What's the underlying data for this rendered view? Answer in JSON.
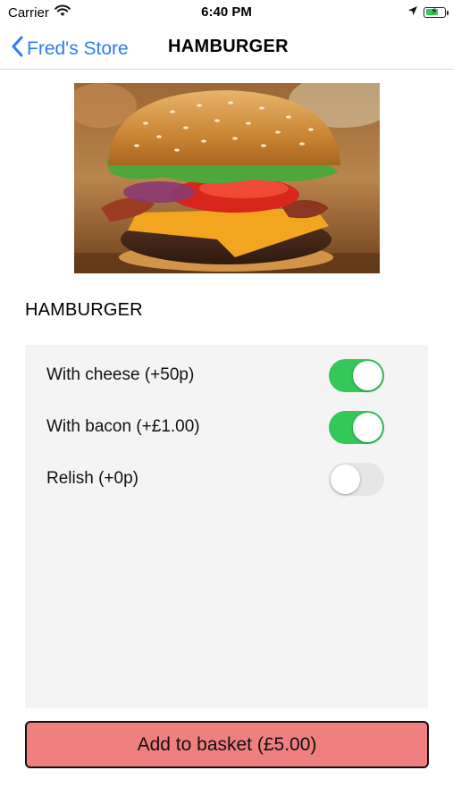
{
  "status_bar": {
    "carrier": "Carrier",
    "time": "6:40 PM",
    "icons": [
      "wifi-icon",
      "location-arrow-icon",
      "battery-charging-icon"
    ]
  },
  "nav": {
    "back_label": "Fred's Store",
    "title": "HAMBURGER"
  },
  "product": {
    "image_alt": "hamburger-photo",
    "title": "HAMBURGER"
  },
  "options": [
    {
      "label": "With cheese (+50p)",
      "enabled": true
    },
    {
      "label": "With bacon (+£1.00)",
      "enabled": true
    },
    {
      "label": "Relish (+0p)",
      "enabled": false
    }
  ],
  "add_button_label": "Add to basket (£5.00)",
  "colors": {
    "accent": "#2f7bf6",
    "toggle_on": "#36c759",
    "add_button": "#f08080"
  }
}
